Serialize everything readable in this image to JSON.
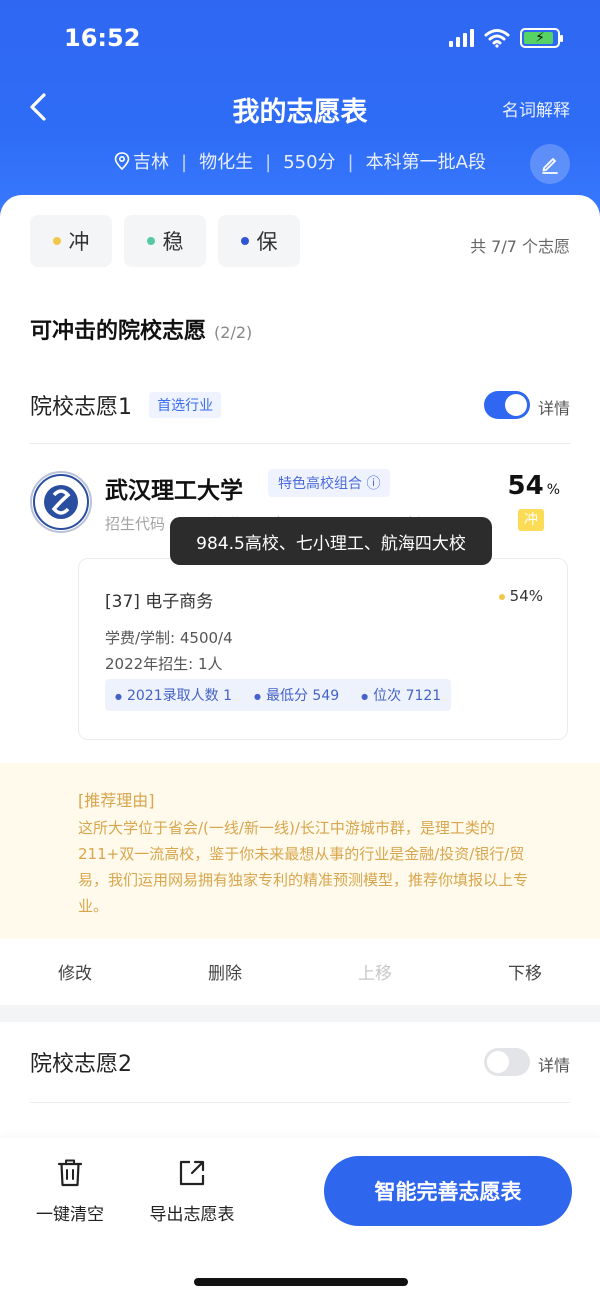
{
  "status_bar": {
    "time": "16:52"
  },
  "nav": {
    "title": "我的志愿表",
    "glossary": "名词解释"
  },
  "profile": {
    "location": "吉林",
    "subjects": "物化生",
    "score": "550分",
    "batch": "本科第一批A段"
  },
  "filters": [
    {
      "label": "冲",
      "color": "#f3c64c"
    },
    {
      "label": "稳",
      "color": "#55c9a0"
    },
    {
      "label": "保",
      "color": "#2f55d4"
    }
  ],
  "count_text": "共 7/7 个志愿",
  "section": {
    "title": "可冲击的院校志愿",
    "count": "(2/2)"
  },
  "choice1": {
    "label": "院校志愿1",
    "tag": "首选行业",
    "detail_label": "详情",
    "university": "武汉理工大学",
    "uni_tag": "特色高校组合 ⓘ",
    "code_line": "招生代码 4208  湖北 · 公办 · 理工 · 不服从调剂",
    "probability": "54",
    "probability_unit": "%",
    "badge": "冲",
    "tooltip": "984.5高校、七小理工、航海四大校",
    "major": {
      "name": "[37] 电子商务",
      "prob": "54%",
      "fee": "学费/学制: 4500/4",
      "enroll": "2022年招生: 1人",
      "stats": [
        "2021录取人数 1",
        "最低分 549",
        "位次 7121"
      ]
    },
    "reason_title": "[推荐理由]",
    "reason_text": "这所大学位于省会/(一线/新一线)/长江中游城市群，是理工类的211+双一流高校，鉴于你未来最想从事的行业是金融/投资/银行/贸易，我们运用网易拥有独家专利的精准预测模型，推荐你填报以上专业。",
    "actions": [
      "修改",
      "删除",
      "上移",
      "下移"
    ]
  },
  "choice2": {
    "label": "院校志愿2",
    "detail_label": "详情"
  },
  "bottom_bar": {
    "clear": "一键清空",
    "export": "导出志愿表",
    "cta": "智能完善志愿表"
  }
}
